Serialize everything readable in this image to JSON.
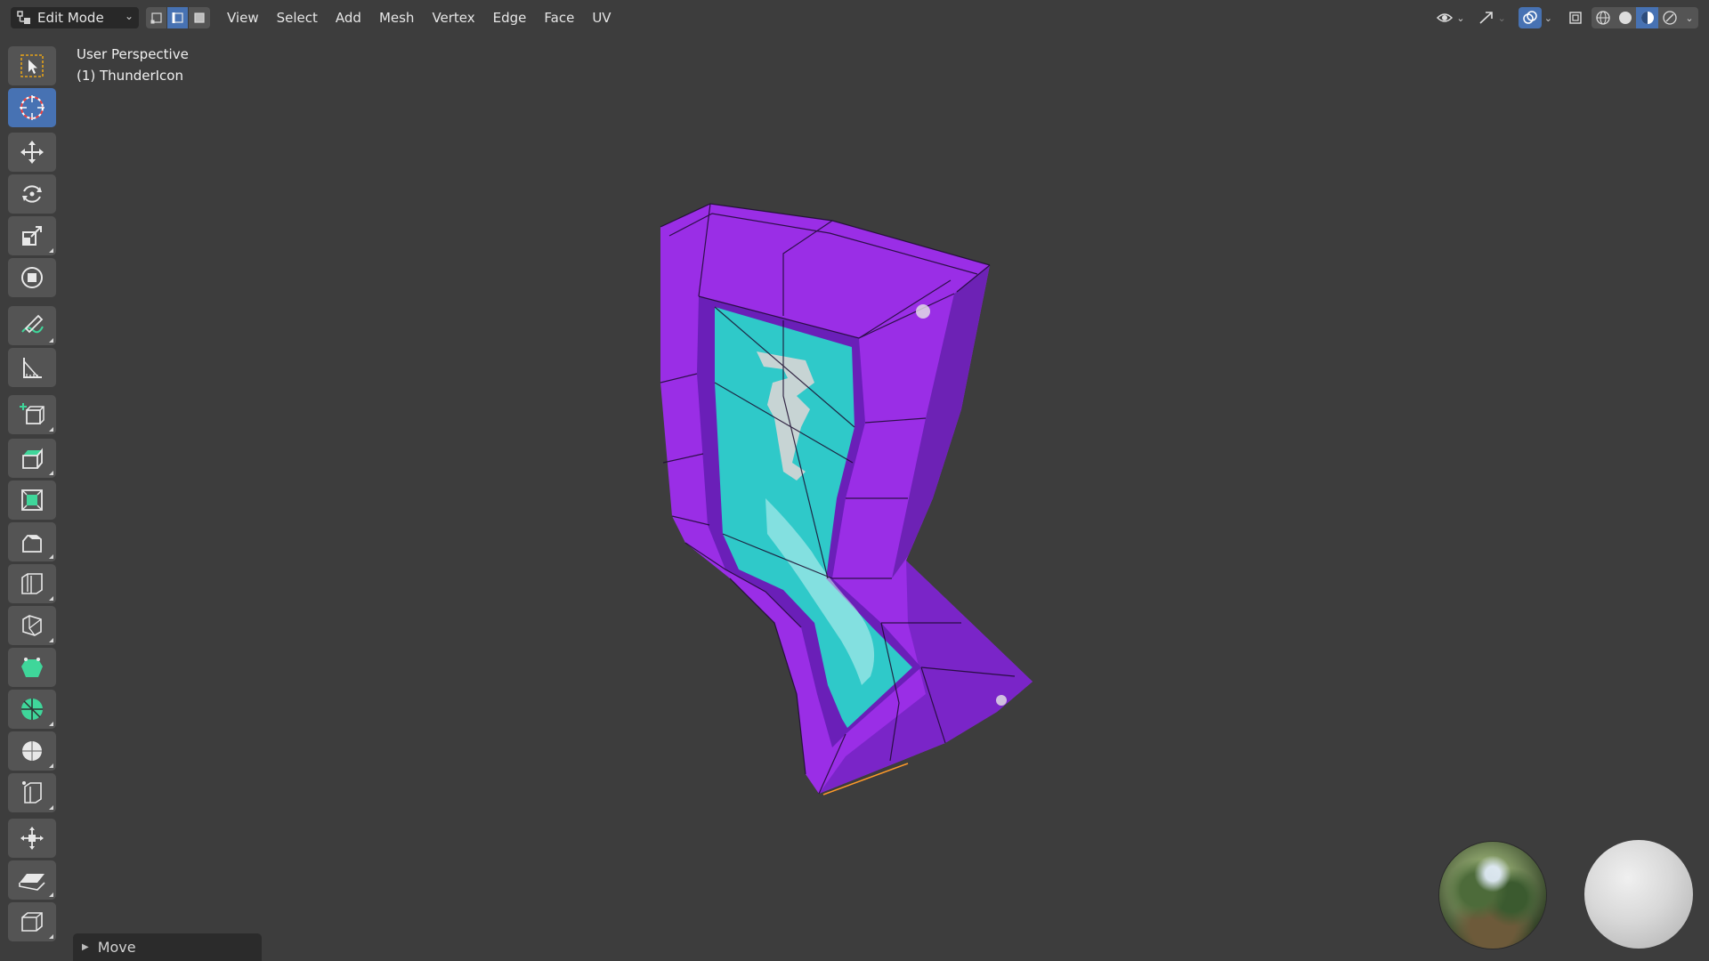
{
  "header": {
    "mode_label": "Edit Mode",
    "select_modes": [
      "vertex-select-mode",
      "edge-select-mode",
      "face-select-mode"
    ],
    "active_select_mode": "edge-select-mode",
    "menus": [
      "View",
      "Select",
      "Add",
      "Mesh",
      "Vertex",
      "Edge",
      "Face",
      "UV"
    ],
    "right_controls": [
      "visibility-icon",
      "gizmo-icon",
      "overlay-icon",
      "xray-icon"
    ],
    "shading_modes": [
      "wireframe",
      "solid",
      "material-preview",
      "rendered"
    ],
    "active_shading": "material-preview"
  },
  "viewport": {
    "perspective_label": "User Perspective",
    "object_label": "(1) ThunderIcon"
  },
  "toolbar": {
    "tools": [
      "select-box",
      "cursor",
      "move",
      "rotate",
      "scale",
      "transform",
      "annotate",
      "measure",
      "add-cube",
      "extrude-region",
      "inset-faces",
      "bevel",
      "loop-cut",
      "knife",
      "poly-build",
      "spin",
      "smooth",
      "edge-slide",
      "shrink-fatten",
      "shear",
      "rip-region"
    ],
    "active_tool": "cursor"
  },
  "last_operation": {
    "label": "Move"
  },
  "colors": {
    "background": "#3d3d3d",
    "accent": "#4772b3",
    "mesh_purple": "#9a2ee6",
    "mesh_cyan": "#2fc9c9"
  }
}
